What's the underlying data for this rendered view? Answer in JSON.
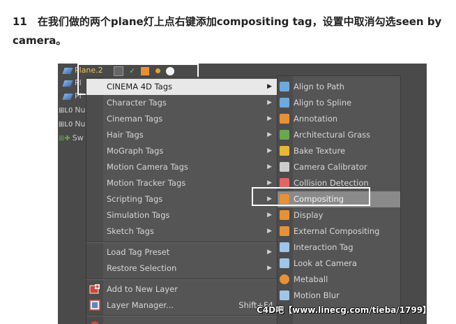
{
  "caption": "11　在我们做的两个plane灯上点右键添加compositing tag，设置中取消勾选seen by camera。",
  "object_manager": {
    "rows": [
      {
        "label": "Plane.2",
        "icon": "plane-icon"
      },
      {
        "label": "Pl",
        "icon": "plane-icon"
      },
      {
        "label": "Pl",
        "icon": "plane-icon"
      },
      {
        "label": "Nu",
        "icon": "null-icon"
      },
      {
        "label": "Nu",
        "icon": "null-icon"
      },
      {
        "label": "Sw",
        "icon": "switch-icon"
      }
    ]
  },
  "context_menu": {
    "items": [
      {
        "label": "CINEMA 4D Tags",
        "submenu": true
      },
      {
        "label": "Character Tags",
        "submenu": true
      },
      {
        "label": "Cineman Tags",
        "submenu": true
      },
      {
        "label": "Hair Tags",
        "submenu": true
      },
      {
        "label": "MoGraph Tags",
        "submenu": true
      },
      {
        "label": "Motion Camera Tags",
        "submenu": true
      },
      {
        "label": "Motion Tracker Tags",
        "submenu": true
      },
      {
        "label": "Scripting Tags",
        "submenu": true
      },
      {
        "label": "Simulation Tags",
        "submenu": true
      },
      {
        "label": "Sketch Tags",
        "submenu": true
      }
    ],
    "items2": [
      {
        "label": "Load Tag Preset",
        "submenu": true
      },
      {
        "label": "Restore Selection",
        "submenu": true
      }
    ],
    "items3": [
      {
        "label": "Add to New Layer",
        "icon": "layer-add-icon"
      },
      {
        "label": "Layer Manager...",
        "icon": "layer-manager-icon",
        "shortcut": "Shift+F4"
      }
    ]
  },
  "submenu": {
    "items": [
      {
        "label": "Align to Path",
        "icon": "align-path-icon",
        "color": "#6fa8dc"
      },
      {
        "label": "Align to Spline",
        "icon": "align-spline-icon",
        "color": "#6fa8dc"
      },
      {
        "label": "Annotation",
        "icon": "annotation-icon",
        "color": "#e69138"
      },
      {
        "label": "Architectural Grass",
        "icon": "grass-icon",
        "color": "#6aa84f"
      },
      {
        "label": "Bake Texture",
        "icon": "bake-texture-icon",
        "color": "#e6b838"
      },
      {
        "label": "Camera Calibrator",
        "icon": "camera-calibrator-icon",
        "color": "#cccccc"
      },
      {
        "label": "Collision Detection",
        "icon": "collision-icon",
        "color": "#e06666"
      },
      {
        "label": "Compositing",
        "icon": "compositing-icon",
        "color": "#e69138"
      },
      {
        "label": "Display",
        "icon": "display-icon",
        "color": "#e69138"
      },
      {
        "label": "External Compositing",
        "icon": "external-compositing-icon",
        "color": "#e69138"
      },
      {
        "label": "Interaction Tag",
        "icon": "interaction-icon",
        "color": "#9fc5e8"
      },
      {
        "label": "Look at Camera",
        "icon": "look-at-camera-icon",
        "color": "#9fc5e8"
      },
      {
        "label": "Metaball",
        "icon": "metaball-icon",
        "color": "#e69138"
      },
      {
        "label": "Motion Blur",
        "icon": "motion-blur-icon",
        "color": "#9fc5e8"
      }
    ]
  },
  "watermark": "C4D吧【www.linecg.com/tieba/1799】"
}
